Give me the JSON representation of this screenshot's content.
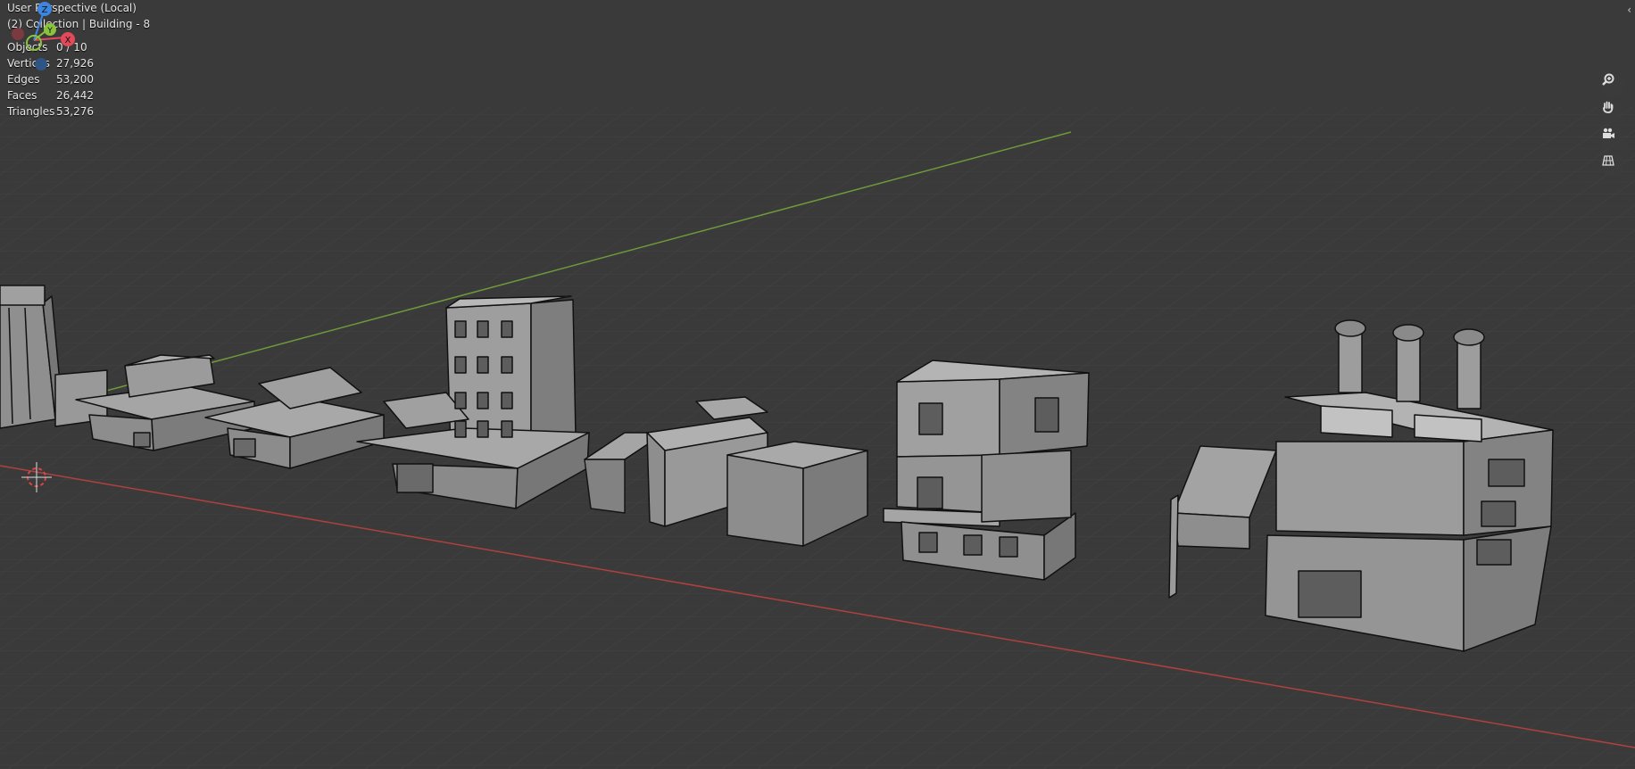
{
  "viewport": {
    "view_name": "User Perspective (Local)",
    "collection_line": "(2) Collection | Building - 8"
  },
  "stats": [
    {
      "label": "Objects",
      "value": "0 / 10"
    },
    {
      "label": "Vertices",
      "value": "27,926"
    },
    {
      "label": "Edges",
      "value": "53,200"
    },
    {
      "label": "Faces",
      "value": "26,442"
    },
    {
      "label": "Triangles",
      "value": "53,276"
    }
  ],
  "gizmo": {
    "z_label": "Z",
    "y_label": "Y",
    "x_label": "X",
    "colors": {
      "x": "#e2495a",
      "y": "#8ac33e",
      "z": "#3c86e0"
    }
  },
  "nav_buttons": [
    {
      "icon": "zoom-icon"
    },
    {
      "icon": "hand-pan-icon"
    },
    {
      "icon": "camera-icon"
    },
    {
      "icon": "grid-ortho-icon"
    }
  ],
  "colors": {
    "background": "#3a3a3a",
    "grid": "#4a4a4a",
    "x_axis": "#b0413e",
    "y_axis": "#6f9a3a",
    "building_fill": "#9a9a9a",
    "building_edge": "#111111"
  }
}
